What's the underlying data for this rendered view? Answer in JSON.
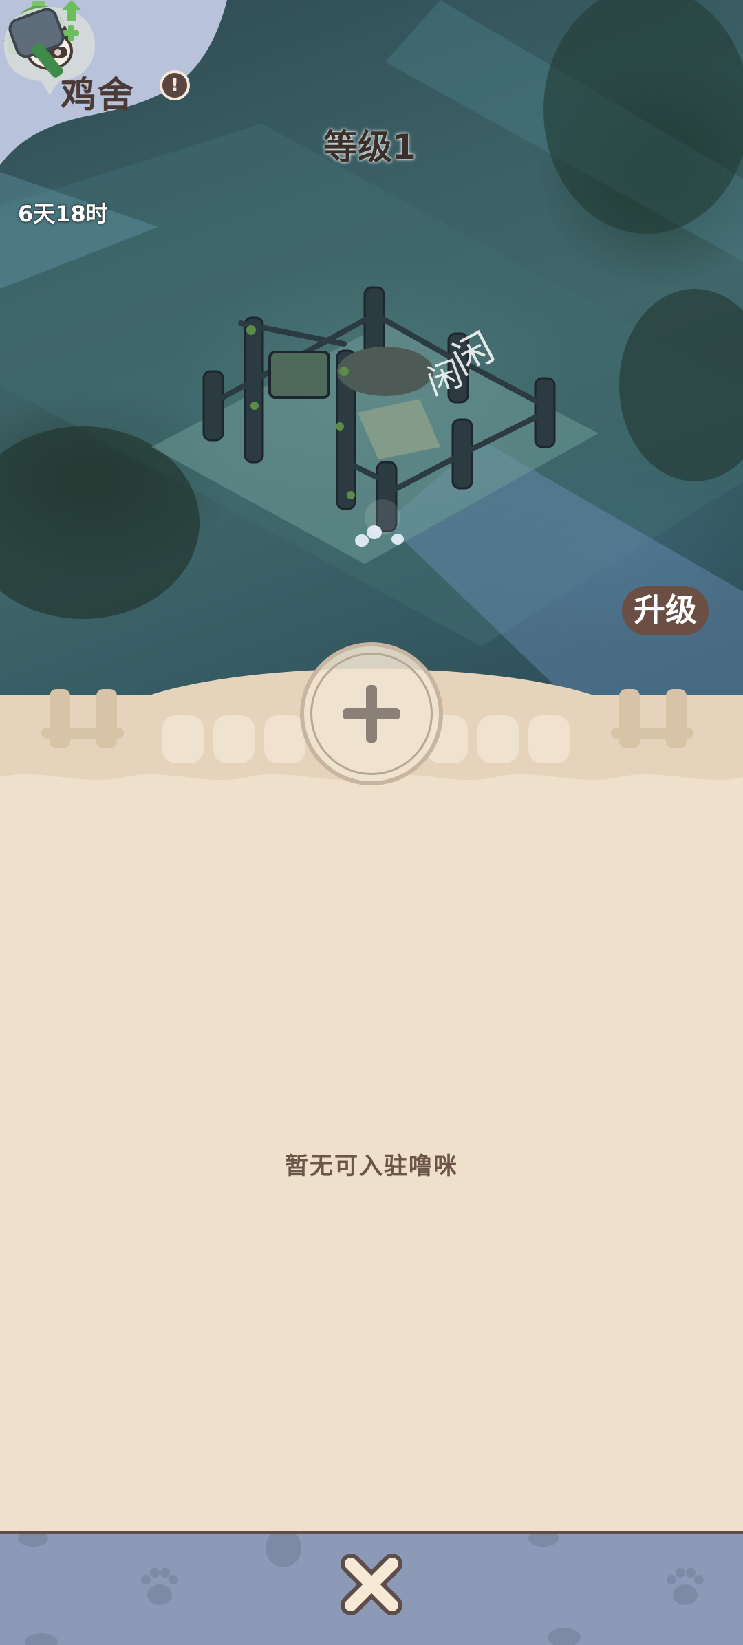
{
  "header": {
    "title": "鸡舍",
    "info_icon": "info-icon",
    "timer_icon": "stopwatch-icon",
    "timer_text": "6天18时"
  },
  "building": {
    "level_label": "等级1",
    "level_icon": "cat-face-add-icon",
    "status_text": "闲",
    "status_text_2": "闲"
  },
  "upgrade": {
    "label": "升级",
    "icon": "hammer-icon"
  },
  "panel": {
    "add_icon": "plus-icon",
    "empty_message": "暂无可入驻噜咪"
  },
  "bottom_bar": {
    "close_icon": "close-x-icon",
    "colors": {
      "bar": "#8c9ab8",
      "panel": "#efe0cb"
    }
  }
}
